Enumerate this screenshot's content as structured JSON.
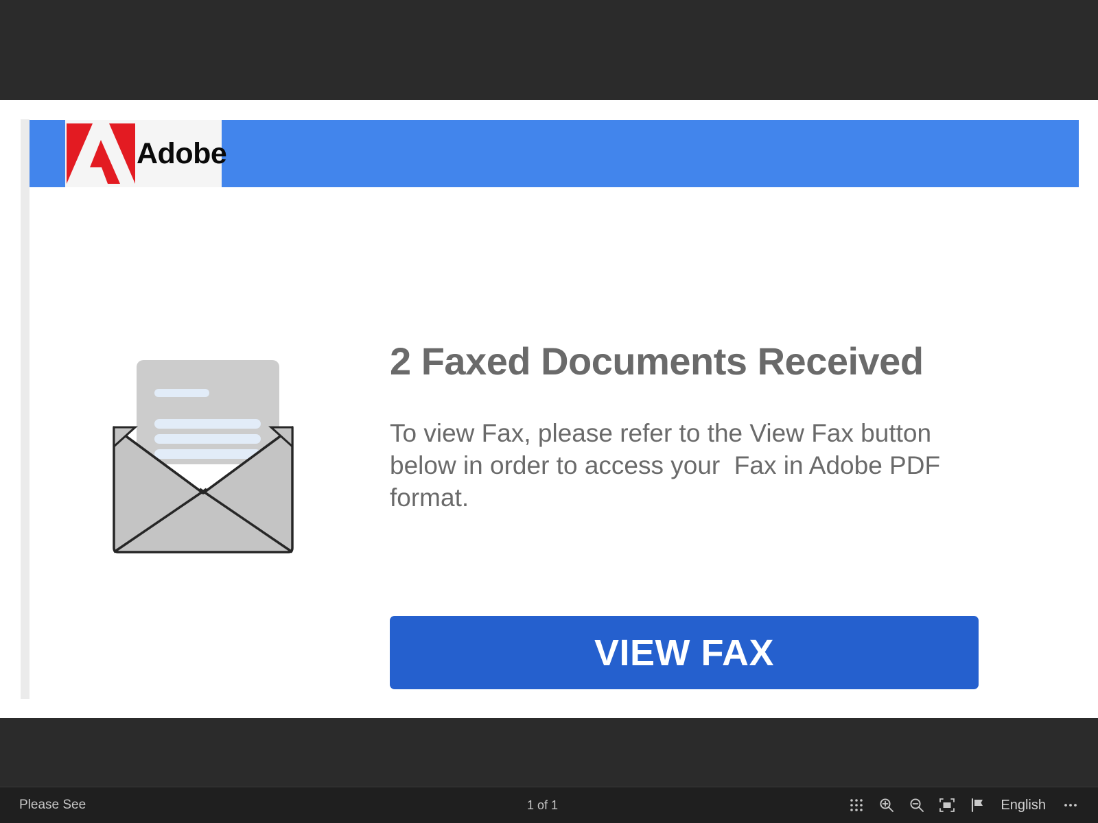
{
  "document": {
    "brand": {
      "logo_icon": "adobe-a-logo-icon",
      "wordmark": "Adobe",
      "banner_color": "#4285ec",
      "logo_red": "#e31b22",
      "logo_plate_color": "#f5f5f5"
    },
    "illustration": {
      "icon": "open-envelope-with-letter-icon",
      "envelope_fill": "#c4c4c4",
      "letter_fill": "#cccccc",
      "letter_line_color": "#e2ecf8",
      "outline_color": "#2b2b2b"
    },
    "headline": "2 Faxed Documents Received",
    "paragraph": "To view Fax, please refer to the View Fax button below in order to access your  Fax in Adobe PDF format.",
    "cta": {
      "label": "VIEW FAX",
      "color": "#2560ce",
      "text_color": "#ffffff"
    },
    "text_color": "#6a6a6a"
  },
  "toolbar": {
    "filename": "Please See",
    "page_info": "1 of 1",
    "language": "English",
    "buttons": [
      {
        "name": "page-thumbnails-icon",
        "title": "Page thumbnails"
      },
      {
        "name": "zoom-in-icon",
        "title": "Zoom in"
      },
      {
        "name": "zoom-out-icon",
        "title": "Zoom out"
      },
      {
        "name": "fit-to-page-icon",
        "title": "Fit to page"
      },
      {
        "name": "flag-icon",
        "title": "Report"
      },
      {
        "name": "more-options-icon",
        "title": "More actions"
      }
    ],
    "background": "#1f1f1f",
    "chrome_background": "#2b2b2b"
  }
}
